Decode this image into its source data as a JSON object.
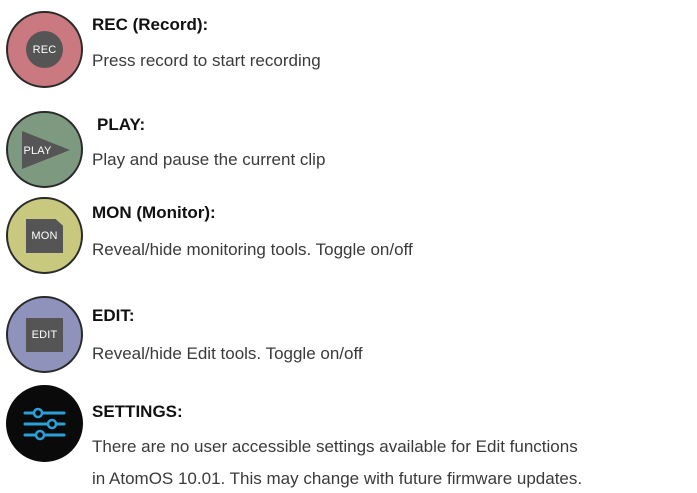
{
  "colors": {
    "rec": "#c9797f",
    "play": "#7d9a80",
    "mon": "#c8c97e",
    "edit": "#8f93bc",
    "settings": "#0a0a0a",
    "settings_lines": "#2a9fd8"
  },
  "items": [
    {
      "icon": "record-button-icon",
      "icon_label": "REC",
      "title": "REC (Record):",
      "description": [
        "Press record to start recording"
      ]
    },
    {
      "icon": "play-button-icon",
      "icon_label": "PLAY",
      "title": "PLAY:",
      "description": [
        "Play and pause the current clip"
      ]
    },
    {
      "icon": "monitor-button-icon",
      "icon_label": "MON",
      "title": "MON (Monitor):",
      "description": [
        "Reveal/hide monitoring tools. Toggle on/off"
      ]
    },
    {
      "icon": "edit-button-icon",
      "icon_label": "EDIT",
      "title": "EDIT:",
      "description": [
        "Reveal/hide Edit tools. Toggle on/off"
      ]
    },
    {
      "icon": "settings-sliders-icon",
      "icon_label": "",
      "title": "SETTINGS:",
      "description": [
        "There are no user accessible settings available for Edit functions",
        "in AtomOS 10.01. This may change with future firmware updates."
      ]
    }
  ]
}
